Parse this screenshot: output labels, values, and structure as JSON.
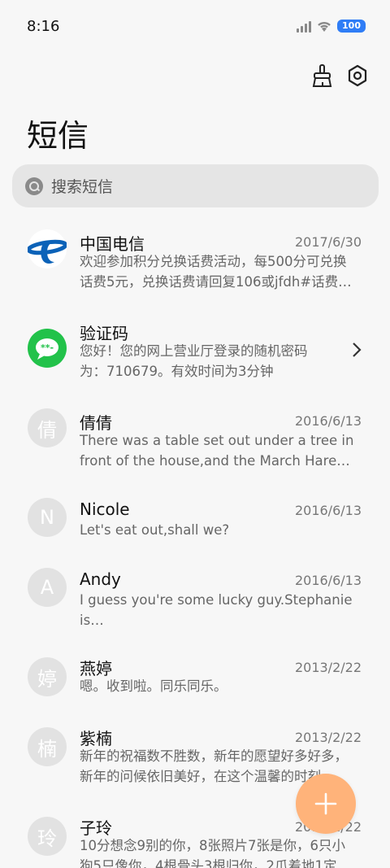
{
  "status": {
    "time": "8:16",
    "battery": "100"
  },
  "header": {
    "title": "短信"
  },
  "search": {
    "placeholder": "搜索短信"
  },
  "messages": [
    {
      "name": "中国电信",
      "date": "2017/6/30",
      "preview": "欢迎参加积分兑换话费活动，每500分可兑换\n话费5元，兑换话费请回复106或jfdh#话费…",
      "avatar": ""
    },
    {
      "name": "验证码",
      "date": "",
      "preview": "您好！您的网上营业厅登录的随机密码\n为：710679。有效时间为3分钟",
      "avatar": ""
    },
    {
      "name": "倩倩",
      "date": "2016/6/13",
      "preview": "There was a table set out under a tree in\nfront of the house,and the March Hare an…",
      "avatar": "倩"
    },
    {
      "name": "Nicole",
      "date": "2016/6/13",
      "preview": "Let's eat out,shall we?",
      "avatar": "N"
    },
    {
      "name": "Andy",
      "date": "2016/6/13",
      "preview": "I guess you're some lucky guy.Stephanie is\na nice girl.",
      "avatar": "A"
    },
    {
      "name": "燕婷",
      "date": "2013/2/22",
      "preview": "嗯。收到啦。同乐同乐。",
      "avatar": "婷"
    },
    {
      "name": "紫楠",
      "date": "2013/2/22",
      "preview": "新年的祝福数不胜数，新年的愿望好多好多，\n新年的问候依旧美好，在这个温馨的时刻…",
      "avatar": "楠"
    },
    {
      "name": "子玲",
      "date": "2013/2/22",
      "preview": "10分想念9别的你，8张照片7张是你，6只小\n狗5只像你，4根骨头3根归你，2爪着地1定",
      "avatar": "玲"
    }
  ]
}
